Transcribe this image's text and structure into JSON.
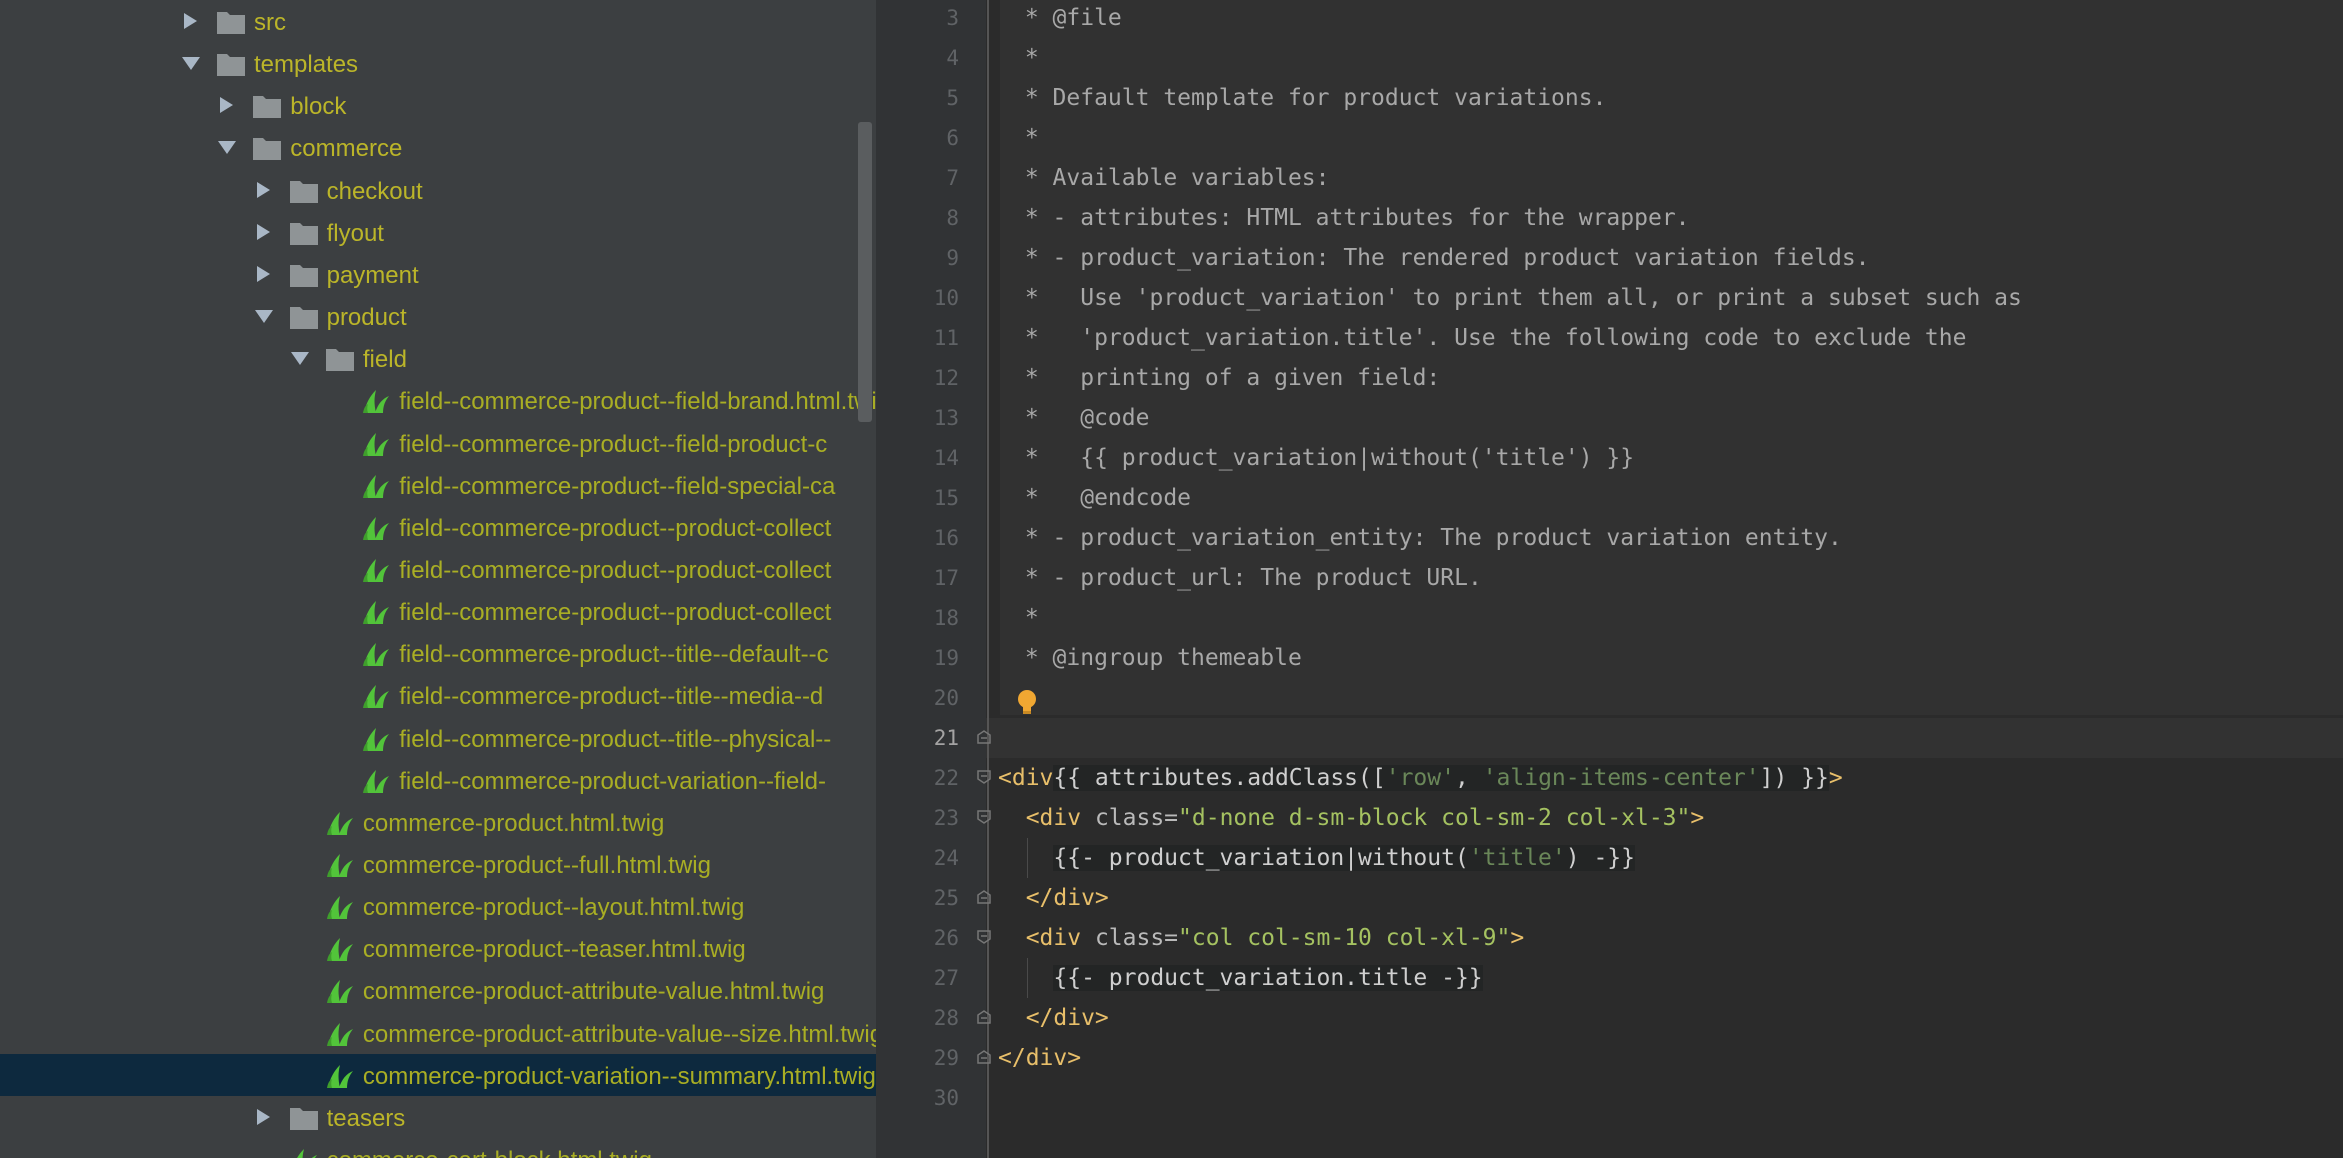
{
  "tree": {
    "rows": [
      {
        "label": "src",
        "kind": "folder",
        "expanded": false
      },
      {
        "label": "templates",
        "kind": "folder",
        "expanded": true
      },
      {
        "label": "block",
        "kind": "folder",
        "expanded": false
      },
      {
        "label": "commerce",
        "kind": "folder",
        "expanded": true
      },
      {
        "label": "checkout",
        "kind": "folder",
        "expanded": false
      },
      {
        "label": "flyout",
        "kind": "folder",
        "expanded": false
      },
      {
        "label": "payment",
        "kind": "folder",
        "expanded": false
      },
      {
        "label": "product",
        "kind": "folder",
        "expanded": true
      },
      {
        "label": "field",
        "kind": "folder",
        "expanded": true
      },
      {
        "label": "field--commerce-product--field-brand.html.twig",
        "kind": "file"
      },
      {
        "label": "field--commerce-product--field-product-c",
        "kind": "file"
      },
      {
        "label": "field--commerce-product--field-special-ca",
        "kind": "file"
      },
      {
        "label": "field--commerce-product--product-collect",
        "kind": "file"
      },
      {
        "label": "field--commerce-product--product-collect",
        "kind": "file"
      },
      {
        "label": "field--commerce-product--product-collect",
        "kind": "file"
      },
      {
        "label": "field--commerce-product--title--default--c",
        "kind": "file"
      },
      {
        "label": "field--commerce-product--title--media--d",
        "kind": "file"
      },
      {
        "label": "field--commerce-product--title--physical--",
        "kind": "file"
      },
      {
        "label": "field--commerce-product-variation--field-",
        "kind": "file"
      },
      {
        "label": "commerce-product.html.twig",
        "kind": "file"
      },
      {
        "label": "commerce-product--full.html.twig",
        "kind": "file"
      },
      {
        "label": "commerce-product--layout.html.twig",
        "kind": "file"
      },
      {
        "label": "commerce-product--teaser.html.twig",
        "kind": "file"
      },
      {
        "label": "commerce-product-attribute-value.html.twig",
        "kind": "file"
      },
      {
        "label": "commerce-product-attribute-value--size.html.twig",
        "kind": "file"
      },
      {
        "label": "commerce-product-variation--summary.html.twig",
        "kind": "file",
        "selected": true
      },
      {
        "label": "teasers",
        "kind": "folder",
        "expanded": false
      },
      {
        "label": "commerce-cart-block.html.twig",
        "kind": "file"
      }
    ]
  },
  "editor": {
    "line_numbers": [
      "3",
      "4",
      "5",
      "6",
      "7",
      "8",
      "9",
      "10",
      "11",
      "12",
      "13",
      "14",
      "15",
      "16",
      "17",
      "18",
      "19",
      "20",
      "21",
      "22",
      "23",
      "24",
      "25",
      "26",
      "27",
      "28",
      "29",
      "30"
    ],
    "current_line": "21",
    "comment_lines": [
      " * @file",
      " *",
      " * Default template for product variations.",
      " *",
      " * Available variables:",
      " * - attributes: HTML attributes for the wrapper.",
      " * - product_variation: The rendered product variation fields.",
      " *   Use 'product_variation' to print them all, or print a subset such as",
      " *   'product_variation.title'. Use the following code to exclude the",
      " *   printing of a given field:",
      " *   @code",
      " *   {{ product_variation|without('title') }}",
      " *   @endcode",
      " * - product_variation_entity: The product variation entity.",
      " * - product_url: The product URL.",
      " *",
      " * @ingroup themeable",
      ""
    ],
    "l21": "#}",
    "l22": {
      "open": "<div",
      "twig": "{{ attributes.addClass([",
      "s1": "'row'",
      "comma": ", ",
      "s2": "'align-items-center'",
      "twig_end": "]) }}",
      "close": ">"
    },
    "l23": {
      "open": "  <div ",
      "attr": "class=",
      "val": "\"d-none d-sm-block col-sm-2 col-xl-3\"",
      "close": ">"
    },
    "l24": {
      "indent": "    ",
      "twig": "{{- product_variation|without(",
      "s1": "'title'",
      "twig_end": ") -}}"
    },
    "l25": "  </div>",
    "l26": {
      "open": "  <div ",
      "attr": "class=",
      "val": "\"col col-sm-10 col-xl-9\"",
      "close": ">"
    },
    "l27": {
      "indent": "    ",
      "twig": "{{- product_variation.title -}}"
    },
    "l28": "  </div>",
    "l29": "</div>",
    "l30": ""
  },
  "colors": {
    "tree_bg": "#3c3f41",
    "tree_selected": "#0d293e",
    "folder_label": "#bbb529",
    "twig_file_icon": "#52c43a",
    "editor_bg": "#2b2b2b",
    "tag": "#e8bf6a",
    "attr_value": "#a5c261"
  }
}
